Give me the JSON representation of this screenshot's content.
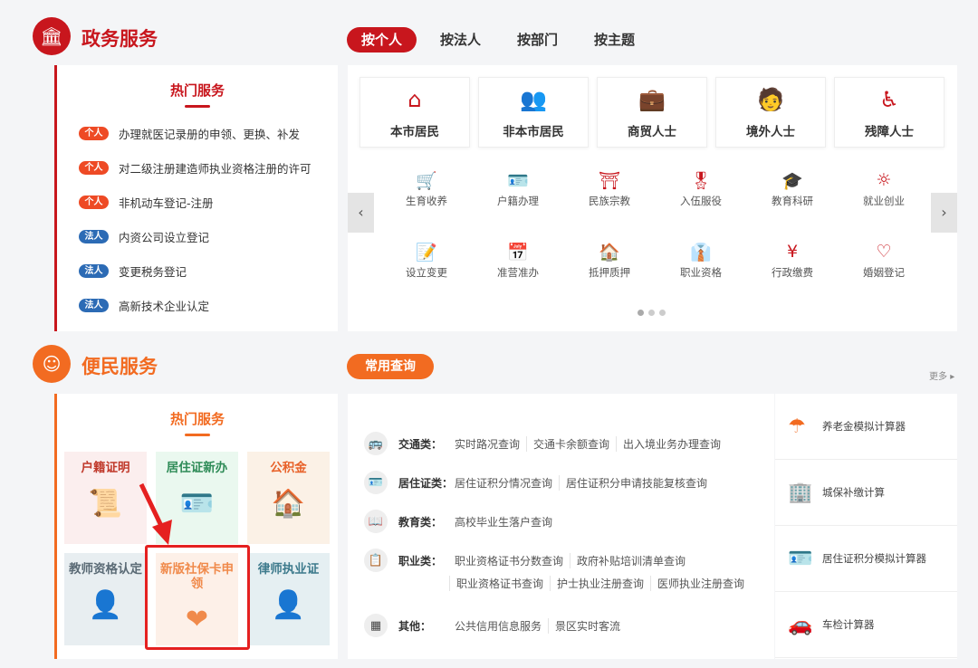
{
  "gov": {
    "title": "政务服务",
    "icon": "government-building-icon",
    "color": "#c8161d",
    "tabs": [
      {
        "label": "按个人",
        "active": true
      },
      {
        "label": "按法人"
      },
      {
        "label": "按部门"
      },
      {
        "label": "按主题"
      }
    ],
    "hot": {
      "title": "热门服务",
      "items": [
        {
          "badge": "个人",
          "type": "personal",
          "text": "办理就医记录册的申领、更换、补发"
        },
        {
          "badge": "个人",
          "type": "personal",
          "text": "对二级注册建造师执业资格注册的许可"
        },
        {
          "badge": "个人",
          "type": "personal",
          "text": "非机动车登记-注册"
        },
        {
          "badge": "法人",
          "type": "legal",
          "text": "内资公司设立登记"
        },
        {
          "badge": "法人",
          "type": "legal",
          "text": "变更税务登记"
        },
        {
          "badge": "法人",
          "type": "legal",
          "text": "高新技术企业认定"
        }
      ]
    },
    "cards": [
      {
        "label": "本市居民",
        "icon": "house-icon"
      },
      {
        "label": "非本市居民",
        "icon": "people-icon"
      },
      {
        "label": "商贸人士",
        "icon": "briefcase-icon"
      },
      {
        "label": "境外人士",
        "icon": "globe-person-icon"
      },
      {
        "label": "残障人士",
        "icon": "wheelchair-icon"
      }
    ],
    "grid": [
      {
        "label": "生育收养",
        "icon": "stroller-icon"
      },
      {
        "label": "户籍办理",
        "icon": "id-card-icon"
      },
      {
        "label": "民族宗教",
        "icon": "temple-icon"
      },
      {
        "label": "入伍服役",
        "icon": "medal-icon"
      },
      {
        "label": "教育科研",
        "icon": "graduation-cap-icon"
      },
      {
        "label": "就业创业",
        "icon": "lightbulb-icon"
      },
      {
        "label": "设立变更",
        "icon": "document-edit-icon"
      },
      {
        "label": "准营准办",
        "icon": "calendar-check-icon"
      },
      {
        "label": "抵押质押",
        "icon": "house-hand-icon"
      },
      {
        "label": "职业资格",
        "icon": "tie-icon"
      },
      {
        "label": "行政缴费",
        "icon": "yen-hand-icon"
      },
      {
        "label": "婚姻登记",
        "icon": "hearts-icon"
      }
    ],
    "carousel": {
      "pages": 3,
      "active": 1
    }
  },
  "conv": {
    "title": "便民服务",
    "icon": "smiley-house-icon",
    "color": "#f26b21",
    "hot": {
      "title": "热门服务",
      "tiles": [
        {
          "label": "户籍证明",
          "icon": "certificate-stamp-icon",
          "bg": "#fbeeee",
          "fg": "#c0392b"
        },
        {
          "label": "居住证新办",
          "icon": "id-card-icon",
          "bg": "#eaf8ef",
          "fg": "#2e8b57"
        },
        {
          "label": "公积金",
          "icon": "house-yen-icon",
          "bg": "#fbf1e6",
          "fg": "#e8622a"
        },
        {
          "label": "教师资格认定",
          "icon": "lectern-icon",
          "bg": "#e8eef1",
          "fg": "#5a6a75"
        },
        {
          "label": "新版社保卡申领",
          "icon": "hands-heart-icon",
          "bg": "#fdf0e8",
          "fg": "#f08a4b",
          "highlighted": true
        },
        {
          "label": "律师执业证",
          "icon": "lawyer-clock-icon",
          "bg": "#e5eff2",
          "fg": "#3d7a8c"
        }
      ]
    },
    "query_tab": "常用查询",
    "more": "更多",
    "queries": [
      {
        "cat": "交通类：",
        "icon": "bus-icon",
        "links": [
          "实时路况查询",
          "交通卡余额查询",
          "出入境业务办理查询"
        ]
      },
      {
        "cat": "居住证类：",
        "icon": "id-card-icon",
        "links": [
          "居住证积分情况查询",
          "居住证积分申请技能复核查询"
        ]
      },
      {
        "cat": "教育类：",
        "icon": "book-icon",
        "links": [
          "高校毕业生落户查询"
        ]
      },
      {
        "cat": "职业类：",
        "icon": "certificate-icon",
        "links": [
          "职业资格证书分数查询",
          "政府补贴培训清单查询"
        ],
        "links2": [
          "职业资格证书查询",
          "护士执业注册查询",
          "医师执业注册查询"
        ]
      },
      {
        "cat": "其他：",
        "icon": "grid-icon",
        "links": [
          "公共信用信息服务",
          "景区实时客流"
        ]
      }
    ],
    "calculators": [
      {
        "label": "养老金模拟计算器",
        "icon": "umbrella-icon"
      },
      {
        "label": "城保补缴计算",
        "icon": "building-icon"
      },
      {
        "label": "居住证积分模拟计算器",
        "icon": "id-card-icon"
      },
      {
        "label": "车检计算器",
        "icon": "car-search-icon"
      }
    ]
  }
}
